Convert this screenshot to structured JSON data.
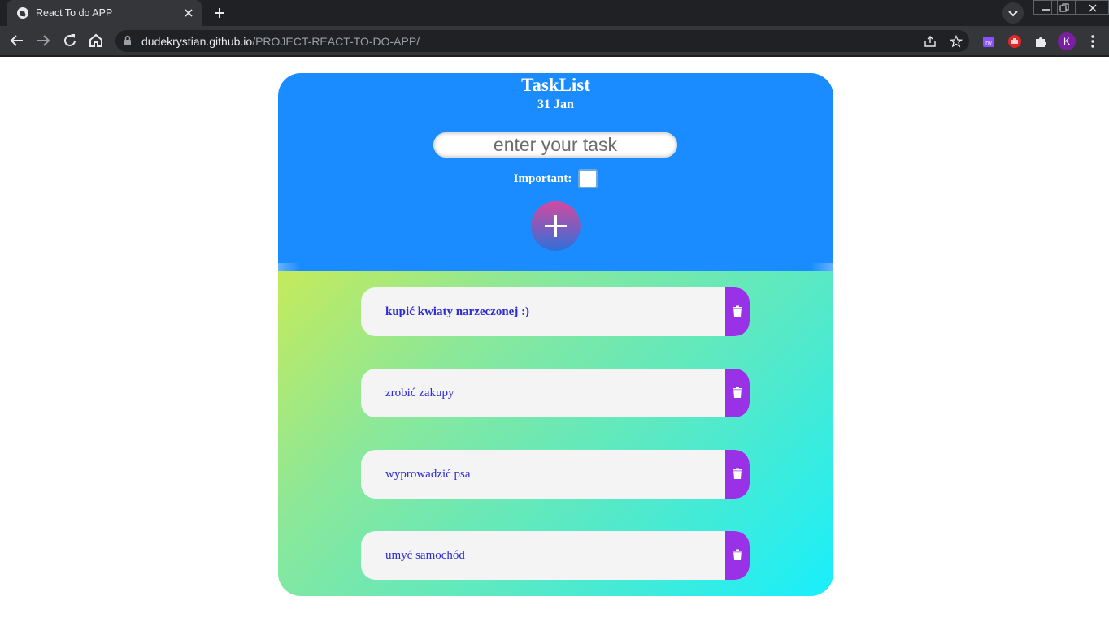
{
  "browser": {
    "tab_title": "React To do APP",
    "url_domain": "dudekrystian.github.io",
    "url_path": "/PROJECT-REACT-TO-DO-APP/",
    "profile_initial": "K"
  },
  "app": {
    "title": "TaskList",
    "date": "31 Jan",
    "input": {
      "placeholder": "enter your task",
      "value": ""
    },
    "important_label": "Important:",
    "important_checked": false,
    "colors": {
      "header": "#1a8cff",
      "delete": "#9932e6",
      "task_text": "#2c2bd6",
      "gradient_start": "#c5ea5c",
      "gradient_end": "#18effc"
    },
    "tasks": [
      {
        "text": "kupić kwiaty narzeczonej :)",
        "important": true
      },
      {
        "text": "zrobić zakupy",
        "important": false
      },
      {
        "text": "wyprowadzić psa",
        "important": false
      },
      {
        "text": "umyć samochód",
        "important": false
      }
    ]
  }
}
